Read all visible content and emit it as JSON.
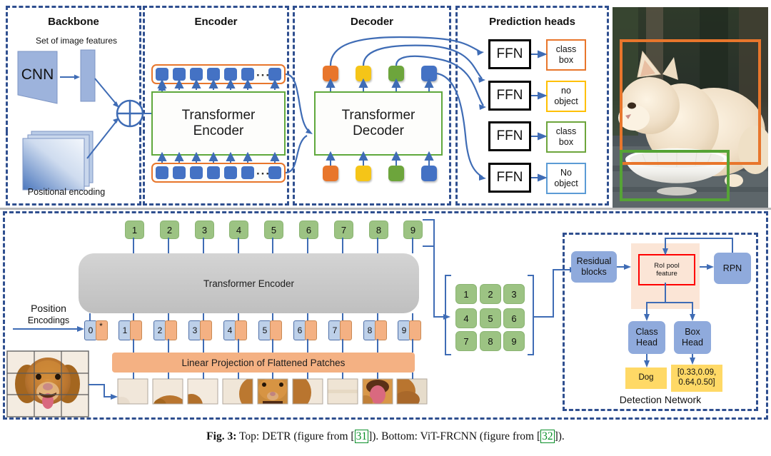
{
  "figure": {
    "caption_prefix": "Fig. 3:",
    "caption_part1": " Top: DETR (figure from [",
    "caption_cite1": "31",
    "caption_part2": "]). Bottom: ViT-FRCNN (figure from [",
    "caption_cite2": "32",
    "caption_part3": "])."
  },
  "colors": {
    "query_orange": "#E8762C",
    "query_yellow": "#F5C518",
    "query_green": "#6DA53C",
    "query_blue": "#4472C4",
    "frame_blue": "#2f4f8f",
    "token_blue": "#4472C4",
    "vit_green": "#9CC383",
    "vit_orange": "#F4B183",
    "det_blue": "#8FAADC",
    "det_yellow": "#FFD966",
    "roi_red": "#FF0000",
    "cite_green": "#0a8f28"
  },
  "detr": {
    "sections": [
      {
        "title": "Backbone"
      },
      {
        "title": "Encoder"
      },
      {
        "title": "Decoder"
      },
      {
        "title": "Prediction heads"
      }
    ],
    "backbone": {
      "cnn_label": "CNN",
      "features_label": "Set of image features",
      "positional_label": "Positional encoding",
      "sum_symbol": "⊕"
    },
    "encoder": {
      "title_line1": "Transformer",
      "title_line2": "Encoder",
      "ellipsis": "···",
      "token_count": 7
    },
    "decoder": {
      "title_line1": "Transformer",
      "title_line2": "Decoder",
      "queries": [
        "#E8762C",
        "#F5C518",
        "#6DA53C",
        "#4472C4"
      ]
    },
    "prediction_heads": {
      "ffn_label": "FFN",
      "outputs": [
        {
          "line1": "class",
          "line2": "box",
          "color": "#E8762C"
        },
        {
          "line1": "no",
          "line2": "object",
          "color": "#FFC000"
        },
        {
          "line1": "class",
          "line2": "box",
          "color": "#6DA53C"
        },
        {
          "line1": "No",
          "line2": "object",
          "color": "#5B9BD5"
        }
      ]
    },
    "result_image": {
      "alt": "cat-beside-bowl-photo",
      "boxes": [
        {
          "name": "cat-bounding-box",
          "color": "#E8762C"
        },
        {
          "name": "bowl-bounding-box",
          "color": "#6DA53C"
        }
      ]
    }
  },
  "vit_frcnn": {
    "output_tokens": [
      "1",
      "2",
      "3",
      "4",
      "5",
      "6",
      "7",
      "8",
      "9"
    ],
    "encoder_label": "Transformer Encoder",
    "position_label_line1": "Position",
    "position_label_line2": "Encodings",
    "cls_token": "0",
    "cls_star": "*",
    "patch_tokens": [
      "1",
      "2",
      "3",
      "4",
      "5",
      "6",
      "7",
      "8",
      "9"
    ],
    "projection_label": "Linear Projection of Flattened Patches",
    "source_image_alt": "golden-retriever-photo-3x3-grid",
    "grid_tokens": [
      [
        "1",
        "2",
        "3"
      ],
      [
        "4",
        "5",
        "6"
      ],
      [
        "7",
        "8",
        "9"
      ]
    ],
    "detection_network": {
      "title": "Detection Network",
      "residual_blocks": {
        "line1": "Residual",
        "line2": "blocks"
      },
      "roi_pool": {
        "line1": "RoI pool",
        "line2": "feature"
      },
      "rpn": "RPN",
      "class_head": {
        "line1": "Class",
        "line2": "Head"
      },
      "box_head": {
        "line1": "Box",
        "line2": "Head"
      },
      "class_output": "Dog",
      "box_output_line1": "[0.33,0.09,",
      "box_output_line2": "0.64,0.50]"
    }
  }
}
